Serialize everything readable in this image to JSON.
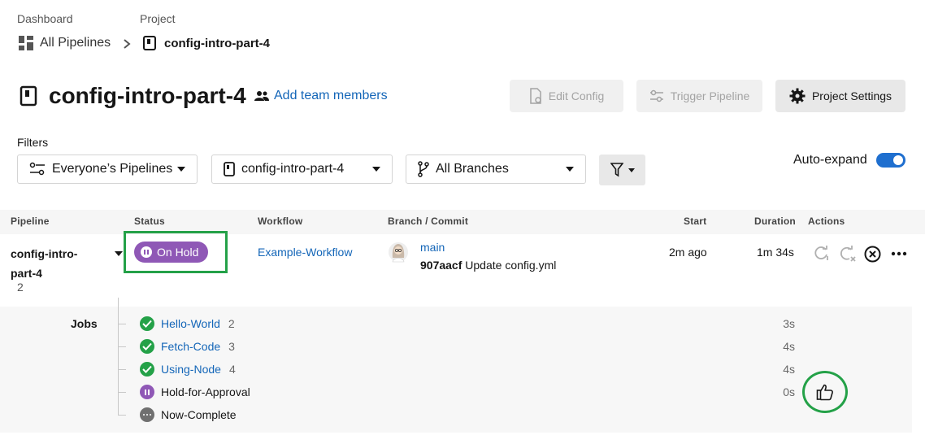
{
  "breadcrumb": {
    "dashboard_label": "Dashboard",
    "project_label": "Project",
    "all_pipelines": "All Pipelines",
    "current_project": "config-intro-part-4"
  },
  "header": {
    "title": "config-intro-part-4",
    "add_team_members": "Add team members",
    "edit_config": "Edit Config",
    "trigger_pipeline": "Trigger Pipeline",
    "project_settings": "Project Settings"
  },
  "filters": {
    "label": "Filters",
    "pipelines": "Everyone’s Pipelines",
    "project": "config-intro-part-4",
    "branches": "All Branches",
    "auto_expand_label": "Auto-expand",
    "auto_expand_on": true
  },
  "table": {
    "columns": [
      "Pipeline",
      "Status",
      "Workflow",
      "Branch / Commit",
      "Start",
      "Duration",
      "Actions"
    ],
    "row": {
      "pipeline_name_line1": "config-intro-",
      "pipeline_name_line2": "part-4",
      "pipeline_number": "2",
      "status": "On Hold",
      "workflow": "Example-Workflow",
      "branch": "main",
      "commit_hash": "907aacf",
      "commit_message": "Update config.yml",
      "start": "2m ago",
      "duration": "1m 34s"
    }
  },
  "jobs": {
    "label": "Jobs",
    "items": [
      {
        "name": "Hello-World",
        "number": "2",
        "status": "success",
        "duration": "3s"
      },
      {
        "name": "Fetch-Code",
        "number": "3",
        "status": "success",
        "duration": "4s"
      },
      {
        "name": "Using-Node",
        "number": "4",
        "status": "success",
        "duration": "4s"
      },
      {
        "name": "Hold-for-Approval",
        "number": "",
        "status": "on-hold",
        "duration": "0s"
      },
      {
        "name": "Now-Complete",
        "number": "",
        "status": "pending",
        "duration": ""
      }
    ]
  },
  "colors": {
    "accent_blue": "#1466b8",
    "on_hold_purple": "#8f58b6",
    "success_green": "#24a148",
    "highlight_green": "#24a148"
  }
}
